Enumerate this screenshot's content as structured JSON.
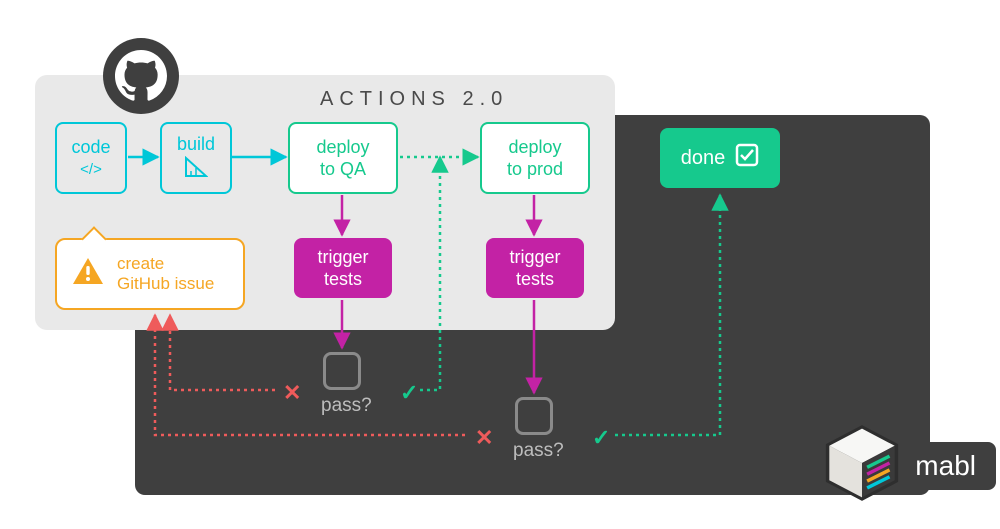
{
  "panel_title": "ACTIONS 2.0",
  "nodes": {
    "code": {
      "label": "code"
    },
    "build": {
      "label": "build"
    },
    "deploy_qa": {
      "line1": "deploy",
      "line2": "to QA"
    },
    "deploy_prod": {
      "line1": "deploy",
      "line2": "to prod"
    },
    "trigger1": {
      "line1": "trigger",
      "line2": "tests"
    },
    "trigger2": {
      "line1": "trigger",
      "line2": "tests"
    },
    "done": {
      "label": "done"
    },
    "issue": {
      "line1": "create",
      "line2": "GitHub issue"
    }
  },
  "decision": {
    "label1": "pass?",
    "label2": "pass?",
    "fail_glyph": "✕",
    "pass_glyph": "✓"
  },
  "brand": {
    "mabl": "mabl"
  },
  "colors": {
    "cyan": "#00c7d8",
    "green": "#16c98d",
    "magenta": "#c322a5",
    "orange": "#f5a623",
    "red": "#ef5b5b",
    "dark": "#3f3f3f"
  }
}
